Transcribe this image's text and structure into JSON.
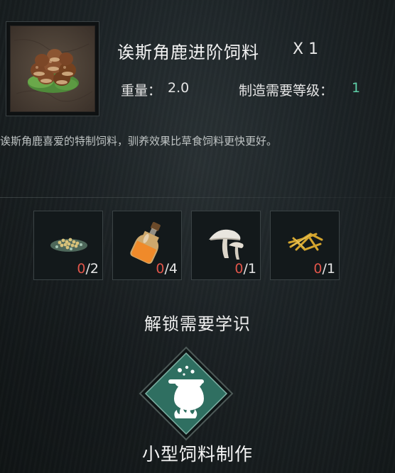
{
  "item": {
    "icon": "chestnut-feed-icon",
    "title": "诶斯角鹿进阶饲料",
    "quantity": "X 1",
    "weight_label": "重量：",
    "weight_value": "2.0",
    "level_label": "制造需要等级：",
    "level_value": "1",
    "description": "诶斯角鹿喜爱的特制饲料，驯养效果比草食饲料更快更好。"
  },
  "materials": [
    {
      "icon": "grain-seeds-icon",
      "have": "0",
      "need": "/2"
    },
    {
      "icon": "potion-bottle-icon",
      "have": "0",
      "need": "/4"
    },
    {
      "icon": "mushroom-icon",
      "have": "0",
      "need": "/1"
    },
    {
      "icon": "golden-straw-icon",
      "have": "0",
      "need": "/1"
    }
  ],
  "unlock": {
    "title": "解锁需要学识",
    "skill_icon": "cauldron-icon",
    "skill_name": "小型饲料制作"
  },
  "colors": {
    "level_value": "#5fd0a8",
    "have_insufficient": "#e0554a",
    "badge_fill": "#2f6f61"
  }
}
